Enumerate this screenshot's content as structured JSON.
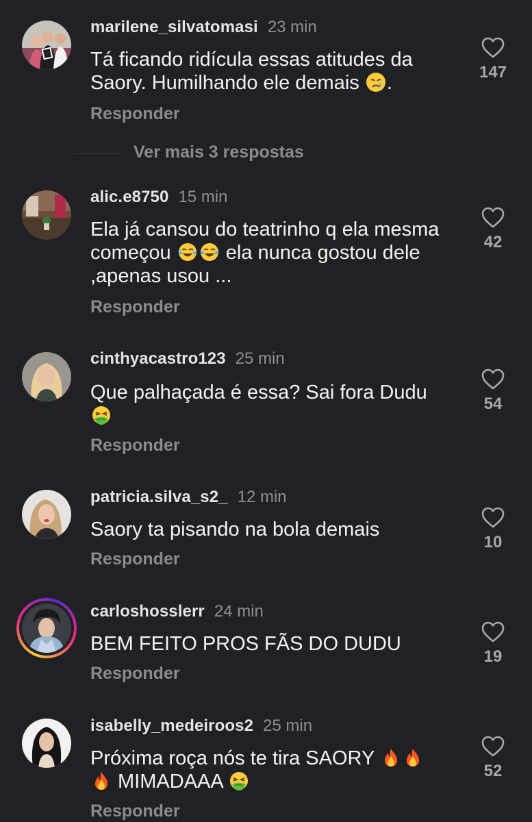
{
  "comments": [
    {
      "username": "marilene_silvatomasi",
      "time": "23 min",
      "text_parts": [
        "Tá ficando ridícula essas atitudes da Saory. Humilhando ele demais ",
        "."
      ],
      "emoji": [
        "crying-face"
      ],
      "reply_label": "Responder",
      "likes": "147"
    },
    {
      "username": "alic.e8750",
      "time": "15 min",
      "text_parts": [
        "Ela já cansou do teatrinho q ela mesma começou ",
        " ela nunca gostou dele ,apenas usou ..."
      ],
      "emoji": [
        "tears-of-joy",
        "tears-of-joy"
      ],
      "reply_label": "Responder",
      "likes": "42"
    },
    {
      "username": "cinthyacastro123",
      "time": "25 min",
      "text_parts": [
        "Que palhaçada é essa? Sai fora Dudu"
      ],
      "emoji": [
        "nauseated-face"
      ],
      "reply_label": "Responder",
      "likes": "54"
    },
    {
      "username": "patricia.silva_s2_",
      "time": "12 min",
      "text_parts": [
        "Saory ta pisando na bola demais"
      ],
      "reply_label": "Responder",
      "likes": "10"
    },
    {
      "username": "carloshosslerr",
      "time": "24 min",
      "text_parts": [
        "BEM FEITO PROS FÃS DO DUDU"
      ],
      "reply_label": "Responder",
      "likes": "19"
    },
    {
      "username": "isabelly_medeiroos2",
      "time": "25 min",
      "text_parts": [
        "Próxima roça nós te tira SAORY ",
        " MIMADAAA "
      ],
      "emoji": [
        "fire",
        "fire",
        "fire",
        "nauseated-face"
      ],
      "reply_label": "Responder",
      "likes": "52"
    }
  ],
  "more_replies_label": "Ver mais 3 respostas",
  "icons": {
    "like": "heart-outline-icon"
  },
  "colors": {
    "background": "#202124",
    "story_ring": [
      "#f9ce34",
      "#ee2a7b",
      "#6228d7"
    ]
  }
}
